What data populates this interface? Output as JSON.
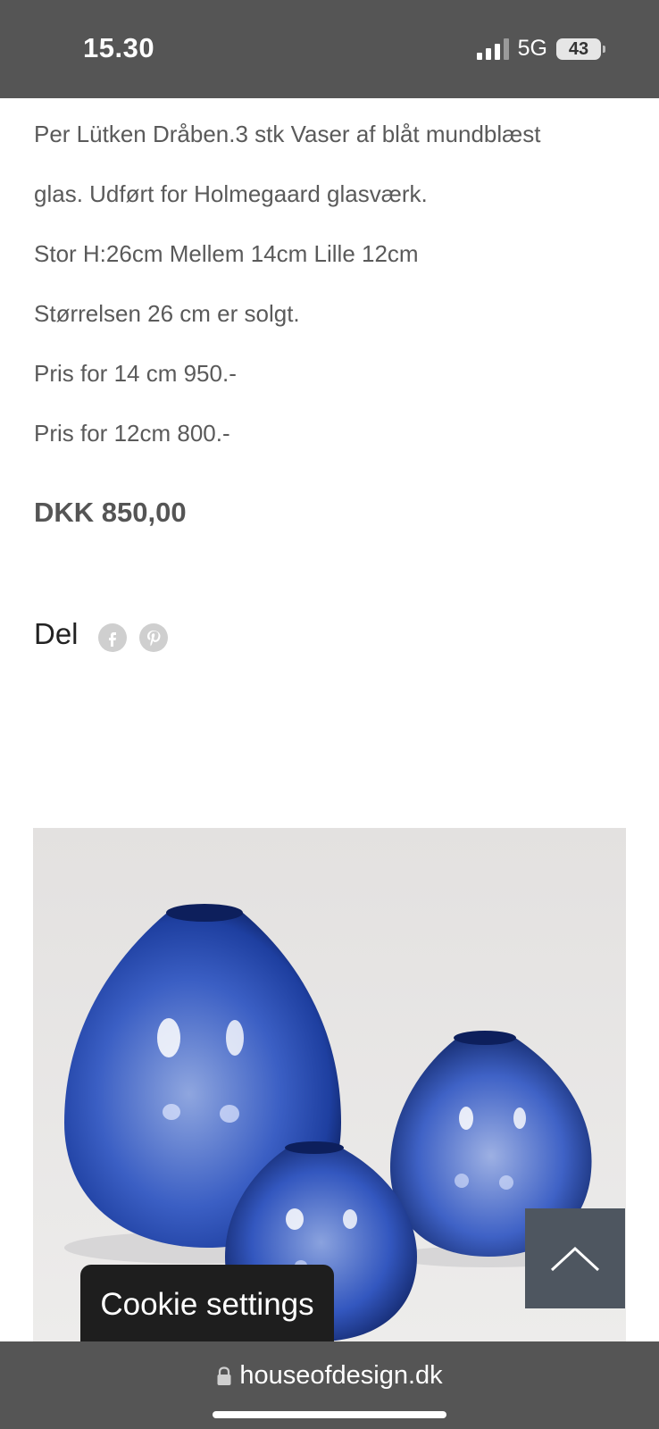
{
  "status_bar": {
    "time": "15.30",
    "network": "5G",
    "battery": "43"
  },
  "product": {
    "description_lines": [
      "Per Lütken Dråben.3 stk Vaser af blåt mundblæst",
      "glas. Udført for Holmegaard glasværk.",
      "Stor H:26cm Mellem 14cm Lille 12cm",
      "Størrelsen 26 cm er solgt.",
      "Pris for 14 cm 950.-",
      "Pris for 12cm 800.-"
    ],
    "price": "DKK 850,00"
  },
  "share": {
    "label": "Del",
    "icons": [
      "facebook-icon",
      "pinterest-icon"
    ]
  },
  "cookie": {
    "label": "Cookie settings"
  },
  "browser": {
    "url": "houseofdesign.dk"
  },
  "colors": {
    "status_bar_bg": "#555555",
    "text_gray": "#5a5a5a",
    "scroll_top_bg": "#4e5660",
    "cookie_bg": "#1e1e1e",
    "glass_blue": "#1e3fa0"
  }
}
